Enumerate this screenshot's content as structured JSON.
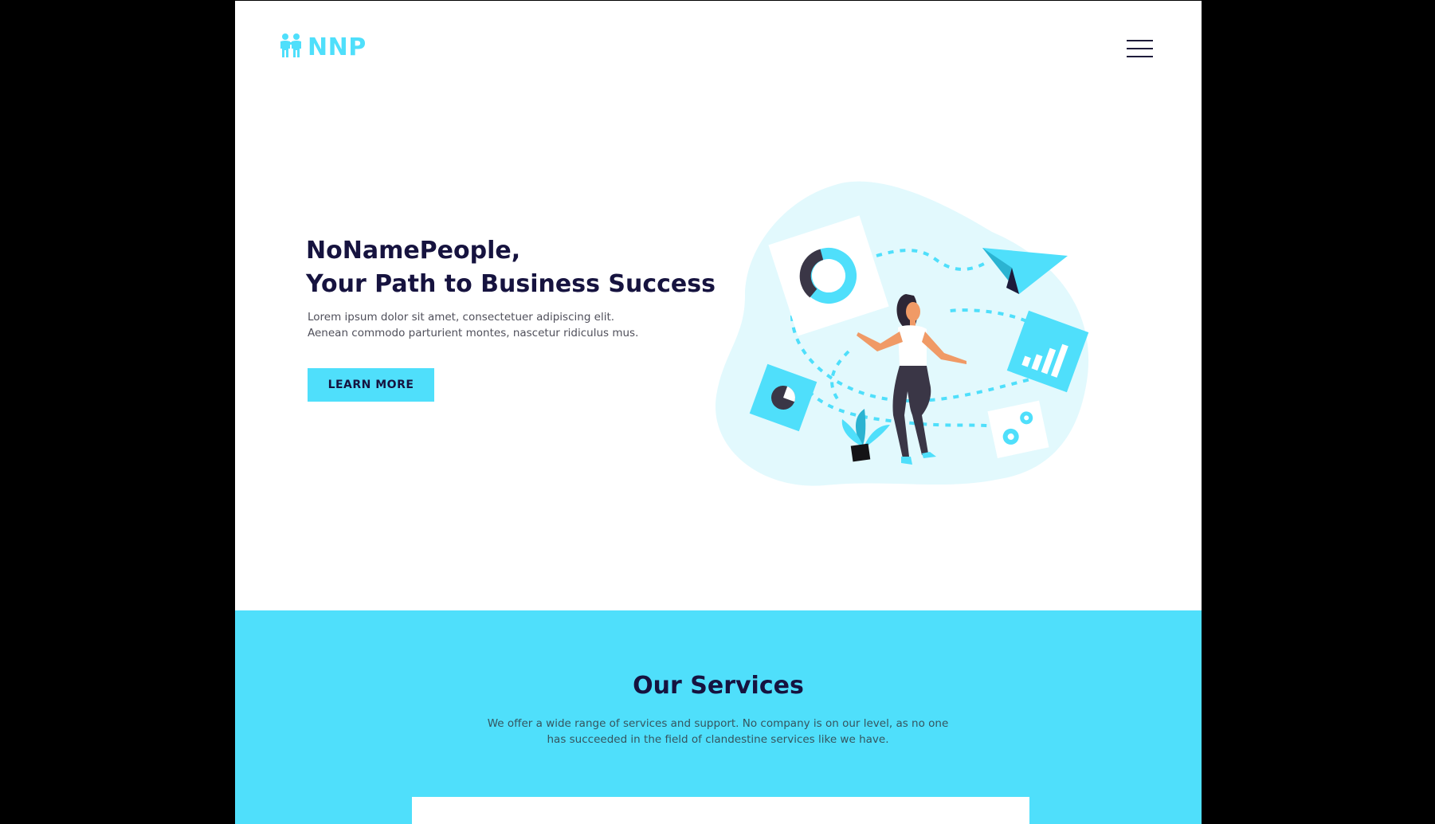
{
  "brand": {
    "logo_text": "NNP",
    "accent_color": "#4fdffb",
    "heading_color": "#16133f"
  },
  "header": {
    "menu_icon": "hamburger-menu-icon"
  },
  "hero": {
    "title_line1": "NoNamePeople,",
    "title_line2": "Your Path to Business Success",
    "description": "Lorem ipsum dolor sit amet, consectetuer adipiscing elit. Aenean commodo parturient montes, nascetur ridiculus mus.",
    "cta_label": "LEARN MORE",
    "illustration": "woman-with-business-icons-illustration"
  },
  "services": {
    "title": "Our Services",
    "description": "We offer a wide range of services and support. No company is on our level, as no one has succeeded in the field of clandestine services like we have."
  }
}
